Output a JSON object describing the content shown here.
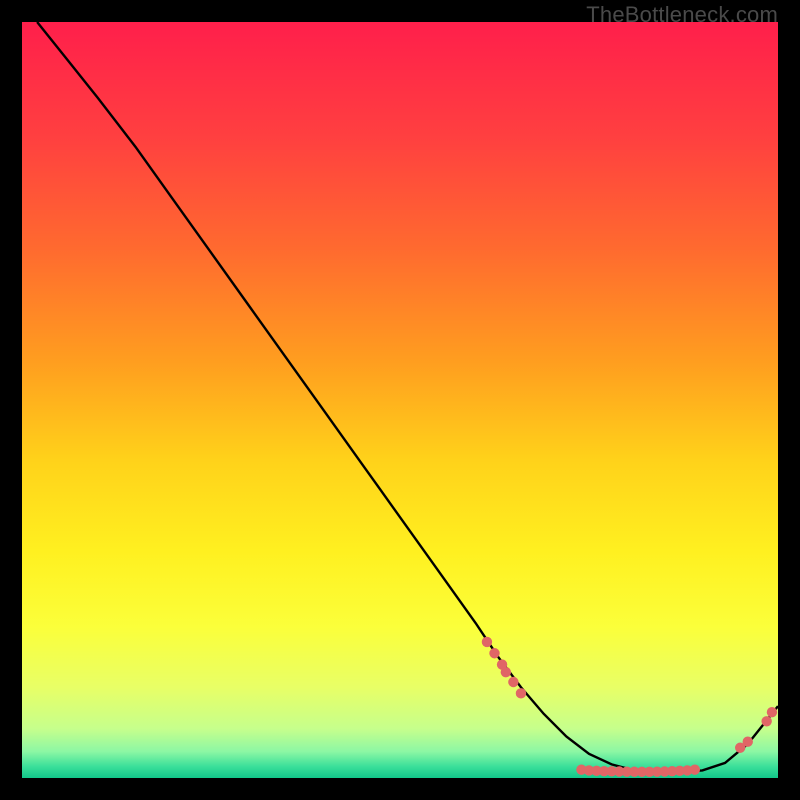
{
  "watermark": "TheBottleneck.com",
  "colors": {
    "bg": "#000000",
    "curve": "#000000",
    "marker": "#e06666",
    "gradient_stops": [
      {
        "offset": 0.0,
        "color": "#ff1f4b"
      },
      {
        "offset": 0.15,
        "color": "#ff3f40"
      },
      {
        "offset": 0.3,
        "color": "#ff6a2f"
      },
      {
        "offset": 0.45,
        "color": "#ff9e1f"
      },
      {
        "offset": 0.58,
        "color": "#ffd21a"
      },
      {
        "offset": 0.7,
        "color": "#fff020"
      },
      {
        "offset": 0.8,
        "color": "#fbff3a"
      },
      {
        "offset": 0.88,
        "color": "#e8ff66"
      },
      {
        "offset": 0.935,
        "color": "#c6ff8c"
      },
      {
        "offset": 0.965,
        "color": "#8cf7a4"
      },
      {
        "offset": 0.985,
        "color": "#3adf9a"
      },
      {
        "offset": 1.0,
        "color": "#12c78a"
      }
    ]
  },
  "chart_data": {
    "type": "line",
    "title": "",
    "xlabel": "",
    "ylabel": "",
    "xlim": [
      0,
      100
    ],
    "ylim": [
      0,
      100
    ],
    "grid": false,
    "legend": false,
    "series": [
      {
        "name": "curve",
        "x": [
          2,
          6,
          10,
          15,
          20,
          25,
          30,
          35,
          40,
          45,
          50,
          55,
          60,
          63,
          66,
          69,
          72,
          75,
          78,
          81,
          84,
          87,
          90,
          93,
          96,
          98,
          100
        ],
        "y": [
          100,
          95,
          90,
          83.5,
          76.5,
          69.5,
          62.5,
          55.5,
          48.5,
          41.5,
          34.5,
          27.5,
          20.5,
          16,
          12,
          8.5,
          5.5,
          3.2,
          1.8,
          1.0,
          0.8,
          0.8,
          1.0,
          2.0,
          4.5,
          7.0,
          9.5
        ]
      }
    ],
    "markers": [
      {
        "x": 61.5,
        "y": 18.0
      },
      {
        "x": 62.5,
        "y": 16.5
      },
      {
        "x": 63.5,
        "y": 15.0
      },
      {
        "x": 64.0,
        "y": 14.0
      },
      {
        "x": 65.0,
        "y": 12.7
      },
      {
        "x": 66.0,
        "y": 11.2
      },
      {
        "x": 74.0,
        "y": 1.1
      },
      {
        "x": 75.0,
        "y": 1.0
      },
      {
        "x": 76.0,
        "y": 0.95
      },
      {
        "x": 77.0,
        "y": 0.9
      },
      {
        "x": 78.0,
        "y": 0.88
      },
      {
        "x": 79.0,
        "y": 0.86
      },
      {
        "x": 80.0,
        "y": 0.84
      },
      {
        "x": 81.0,
        "y": 0.83
      },
      {
        "x": 82.0,
        "y": 0.82
      },
      {
        "x": 83.0,
        "y": 0.82
      },
      {
        "x": 84.0,
        "y": 0.84
      },
      {
        "x": 85.0,
        "y": 0.86
      },
      {
        "x": 86.0,
        "y": 0.9
      },
      {
        "x": 87.0,
        "y": 0.95
      },
      {
        "x": 88.0,
        "y": 1.0
      },
      {
        "x": 89.0,
        "y": 1.1
      },
      {
        "x": 95.0,
        "y": 4.0
      },
      {
        "x": 96.0,
        "y": 4.8
      },
      {
        "x": 98.5,
        "y": 7.5
      },
      {
        "x": 99.2,
        "y": 8.7
      }
    ]
  }
}
